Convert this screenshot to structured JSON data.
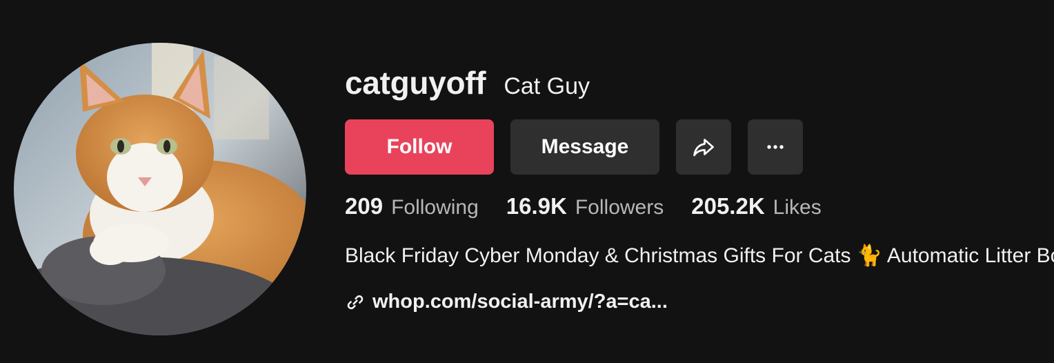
{
  "profile": {
    "username": "catguyoff",
    "nickname": "Cat Guy"
  },
  "actions": {
    "follow_label": "Follow",
    "message_label": "Message",
    "share_icon": "share-arrow-icon",
    "more_icon": "more-horizontal-icon"
  },
  "stats": {
    "following_count": "209",
    "following_label": "Following",
    "followers_count": "16.9K",
    "followers_label": "Followers",
    "likes_count": "205.2K",
    "likes_label": "Likes"
  },
  "bio": {
    "text": "Black Friday Cyber Monday & Christmas Gifts For Cats 🐈 Automatic Litter Box"
  },
  "link": {
    "icon": "link-icon",
    "text": "whop.com/social-army/?a=ca..."
  },
  "colors": {
    "background": "#121212",
    "follow_button": "#e9435b",
    "secondary_button": "#2f2f2f",
    "muted_text": "#b8b8b9"
  }
}
